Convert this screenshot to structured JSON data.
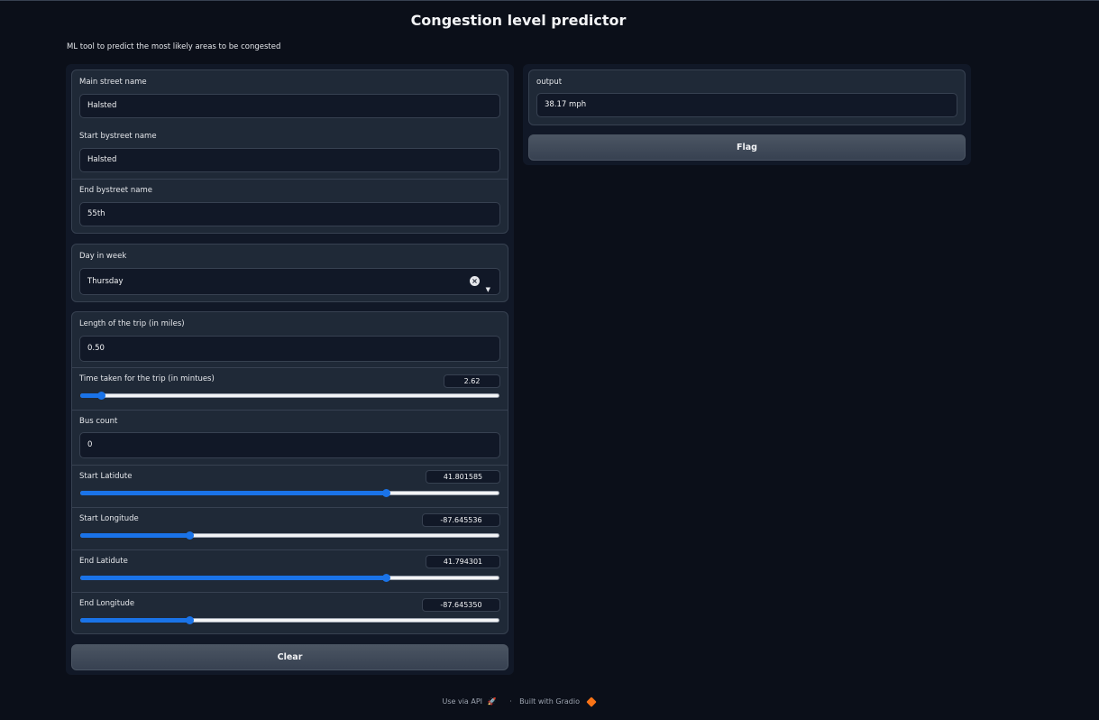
{
  "header": {
    "title": "Congestion level predictor",
    "description": "ML tool to predict the most likely areas to be congested"
  },
  "inputs": {
    "main_street": {
      "label": "Main street name",
      "value": "Halsted"
    },
    "start_bystreet": {
      "label": "Start bystreet name",
      "value": "Halsted"
    },
    "end_bystreet": {
      "label": "End bystreet name",
      "value": "55th"
    },
    "day": {
      "label": "Day in week",
      "value": "Thursday"
    },
    "length": {
      "label": "Length of the trip (in miles)",
      "value": "0.50"
    },
    "time_taken": {
      "label": "Time taken for the trip (in mintues)",
      "value": "2.62",
      "level": 0.05
    },
    "bus_count": {
      "label": "Bus count",
      "value": "0"
    },
    "start_lat": {
      "label": "Start Latidute",
      "value": "41.801585",
      "level": 0.73
    },
    "start_lon": {
      "label": "Start Longitude",
      "value": "-87.645536",
      "level": 0.26
    },
    "end_lat": {
      "label": "End Latidute",
      "value": "41.794301",
      "level": 0.73
    },
    "end_lon": {
      "label": "End Longitude",
      "value": "-87.645350",
      "level": 0.26
    }
  },
  "buttons": {
    "clear": "Clear",
    "flag": "Flag"
  },
  "output": {
    "label": "output",
    "value": "38.17 mph"
  },
  "footer": {
    "api": "Use via API",
    "separator": "·",
    "built": "Built with Gradio"
  },
  "colors": {
    "accent": "#1a73e8",
    "background": "#0b0f19",
    "panel": "#1f2937"
  }
}
